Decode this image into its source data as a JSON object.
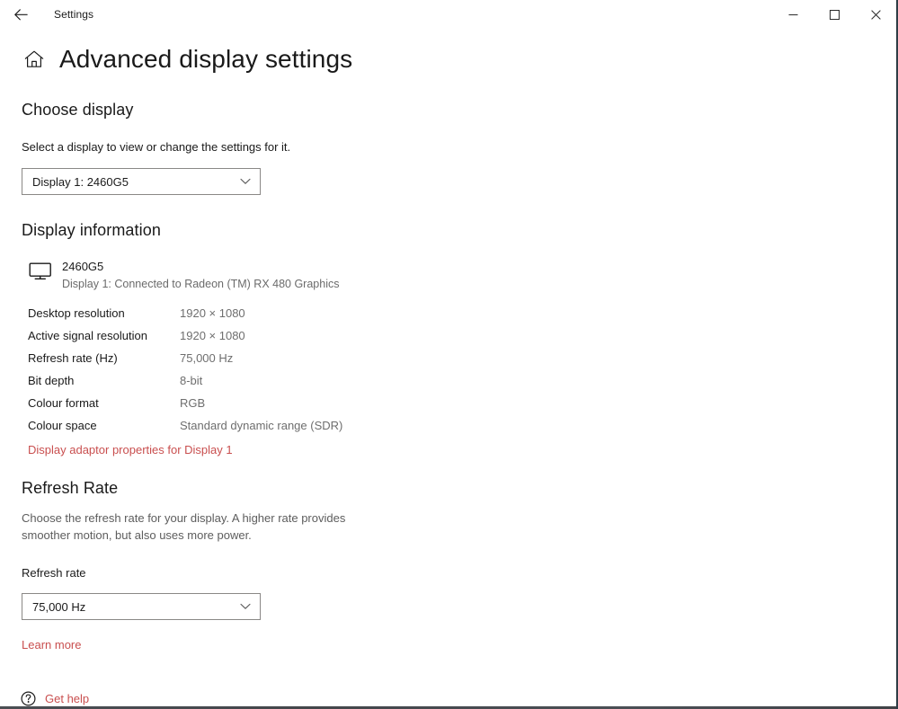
{
  "window": {
    "app_title": "Settings",
    "back_icon": "back-arrow-icon",
    "minimize_label": "Minimise",
    "maximize_label": "Maximise",
    "close_label": "Close"
  },
  "page": {
    "home_icon": "home-icon",
    "title": "Advanced display settings"
  },
  "choose_display": {
    "heading": "Choose display",
    "description": "Select a display to view or change the settings for it.",
    "dropdown": {
      "name": "display-select",
      "value": "Display 1: 2460G5",
      "options": [
        "Display 1: 2460G5"
      ],
      "chevron_icon": "chevron-down-icon"
    }
  },
  "display_information": {
    "heading": "Display information",
    "device": {
      "icon": "monitor-icon",
      "name": "2460G5",
      "connection": "Display 1: Connected to Radeon (TM) RX 480 Graphics"
    },
    "rows": [
      {
        "label": "Desktop resolution",
        "value": "1920 × 1080"
      },
      {
        "label": "Active signal resolution",
        "value": "1920 × 1080"
      },
      {
        "label": "Refresh rate (Hz)",
        "value": "75,000 Hz"
      },
      {
        "label": "Bit depth",
        "value": "8-bit"
      },
      {
        "label": "Colour format",
        "value": "RGB"
      },
      {
        "label": "Colour space",
        "value": "Standard dynamic range (SDR)"
      }
    ],
    "adaptor_link": "Display adaptor properties for Display 1"
  },
  "refresh_rate": {
    "heading": "Refresh Rate",
    "description": "Choose the refresh rate for your display. A higher rate provides smoother motion, but also uses more power.",
    "field_label": "Refresh rate",
    "dropdown": {
      "name": "refresh-rate-select",
      "value": "75,000 Hz",
      "options": [
        "75,000 Hz"
      ],
      "chevron_icon": "chevron-down-icon"
    },
    "learn_more": "Learn more"
  },
  "footer": {
    "help_icon": "question-mark-circle-icon",
    "get_help": "Get help"
  },
  "colors": {
    "link": "#c94f4f",
    "text_primary": "#1a1a1a",
    "text_secondary": "#6e6e6e",
    "background": "#ffffff",
    "combo_border": "#8a8886"
  }
}
